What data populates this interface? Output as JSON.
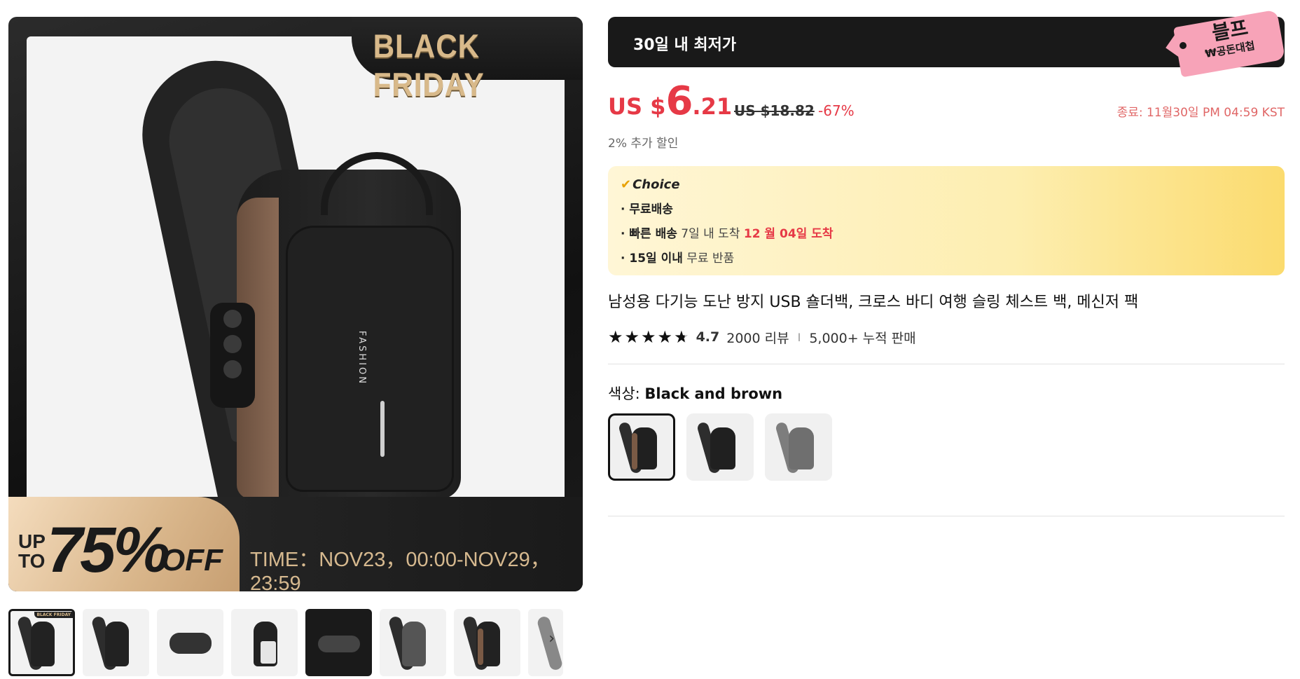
{
  "gallery": {
    "banner_title": "BLACK FRIDAY",
    "promo_upto": "UP TO",
    "promo_percent": "75%",
    "promo_off": "OFF",
    "promo_time": "TIME：NOV23，00:00-NOV29，23:59",
    "bag_label": "FASHION",
    "thumb_banner": "BLACK FRIDAY",
    "next_icon": "chevron-right-icon"
  },
  "deal": {
    "label": "30일 내 최저가",
    "tag_line1": "블프",
    "tag_line2": "₩공돈대첩"
  },
  "price": {
    "currency": "US $",
    "integer": "6",
    "decimal": ".21",
    "original": "US $18.82",
    "discount": "-67%",
    "end_time": "종료: 11월30일 PM 04:59 KST",
    "extra_discount": "2% 추가 할인"
  },
  "choice": {
    "check_icon": "✔",
    "title": "Choice",
    "free_shipping": "· 무료배송",
    "fast_label": "· 빠른 배송",
    "fast_days": " 7일 내 도착 ",
    "fast_date": "12 월 04일 도착",
    "return_label": "· 15일 이내",
    "return_text": "  무료 반품"
  },
  "product": {
    "title": "남성용 다기능 도난 방지 USB 숄더백, 크로스 바디 여행 슬링 체스트 백, 메신저 팩",
    "rating": 4.7,
    "rating_text": "4.7",
    "reviews": "2000 리뷰",
    "separator": "I",
    "sold": "5,000+ 누적 판매",
    "color_label": "색상: ",
    "color_value": "Black and brown"
  },
  "colors": {
    "accent_red": "#e63946",
    "deal_bar": "#191919",
    "tag_pink": "#f7a3b8",
    "choice_gold": "#fbdb6e"
  }
}
